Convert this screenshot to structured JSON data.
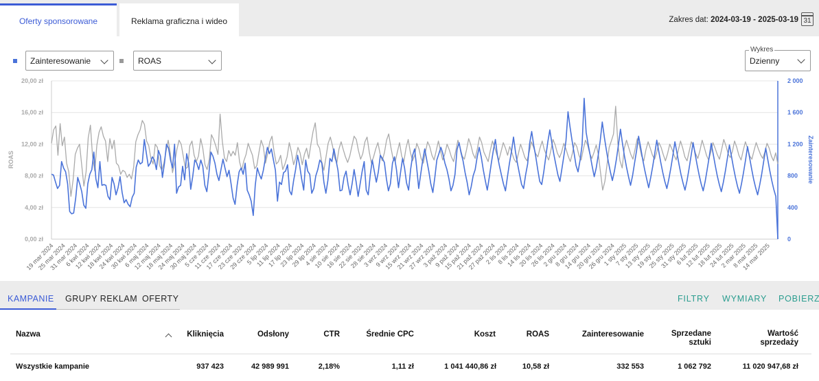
{
  "tabs": [
    {
      "label": "Oferty sponsorowane",
      "active": true
    },
    {
      "label": "Reklama graficzna i wideo",
      "active": false
    }
  ],
  "date_range": {
    "prefix": "Zakres dat: ",
    "value": "2024-03-19 - 2025-03-19",
    "calendar_day": "31"
  },
  "controls": {
    "metric1": "Zainteresowanie",
    "metric2": "ROAS",
    "chart_label": "Wykres",
    "granularity": "Dzienny",
    "metric1_color": "#4a73d9",
    "metric2_color": "#aaaaaa"
  },
  "chart_data": {
    "type": "line",
    "x_start": "2024-03-19",
    "x_end": "2025-03-19",
    "x_tick_labels": [
      "19 mar 2024",
      "25 mar 2024",
      "31 mar 2024",
      "6 kwi 2024",
      "12 kwi 2024",
      "18 kwi 2024",
      "24 kwi 2024",
      "30 kwi 2024",
      "6 maj 2024",
      "12 maj 2024",
      "18 maj 2024",
      "24 maj 2024",
      "30 maj 2024",
      "5 cze 2024",
      "11 cze 2024",
      "17 cze 2024",
      "23 cze 2024",
      "29 cze 2024",
      "5 lip 2024",
      "11 lip 2024",
      "17 lip 2024",
      "23 lip 2024",
      "29 lip 2024",
      "4 sie 2024",
      "10 sie 2024",
      "16 sie 2024",
      "22 sie 2024",
      "28 sie 2024",
      "3 wrz 2024",
      "9 wrz 2024",
      "15 wrz 2024",
      "21 wrz 2024",
      "27 wrz 2024",
      "3 paź 2024",
      "9 paź 2024",
      "15 paź 2024",
      "21 paź 2024",
      "27 paź 2024",
      "2 lis 2024",
      "8 lis 2024",
      "14 lis 2024",
      "20 lis 2024",
      "26 lis 2024",
      "2 gru 2024",
      "8 gru 2024",
      "14 gru 2024",
      "20 gru 2024",
      "26 gru 2024",
      "1 sty 2025",
      "7 sty 2025",
      "13 sty 2025",
      "19 sty 2025",
      "25 sty 2025",
      "31 sty 2025",
      "6 lut 2025",
      "12 lut 2025",
      "18 lut 2025",
      "24 lut 2025",
      "2 mar 2025",
      "8 mar 2025",
      "14 mar 2025"
    ],
    "y_left": {
      "label": "ROAS",
      "ticks": [
        "0,00 zł",
        "4,00 zł",
        "8,00 zł",
        "12,00 zł",
        "16,00 zł",
        "20,00 zł"
      ],
      "ylim": [
        0,
        20
      ]
    },
    "y_right": {
      "label": "Zainteresowanie",
      "ticks": [
        "0",
        "400",
        "800",
        "1 200",
        "1 600",
        "2 000"
      ],
      "ylim": [
        0,
        2000
      ]
    },
    "grid": true,
    "series": [
      {
        "name": "ROAS",
        "axis": "left",
        "color": "#aaaaaa",
        "values": [
          12.1,
          13.8,
          14.3,
          10.6,
          14.6,
          11.8,
          12.9,
          9.6,
          8.5,
          5.4,
          7.5,
          10.7,
          11.5,
          12.0,
          9.3,
          6.7,
          8.5,
          12.8,
          14.4,
          10.5,
          8.6,
          11.9,
          13.5,
          14.2,
          13.0,
          12.4,
          9.8,
          12.7,
          11.4,
          12.5,
          9.6,
          9.3,
          8.2,
          8.7,
          8.5,
          7.8,
          8.2,
          7.6,
          9.1,
          12.3,
          13.2,
          13.8,
          15.0,
          14.5,
          12.4,
          11.8,
          10.2,
          9.5,
          12.0,
          11.6,
          9.3,
          8.7,
          9.6,
          11.1,
          12.5,
          10.8,
          8.4,
          9.7,
          11.3,
          12.5,
          12.0,
          10.4,
          8.9,
          9.1,
          11.8,
          12.4,
          10.6,
          9.8,
          10.5,
          12.7,
          11.5,
          9.4,
          8.8,
          10.1,
          13.2,
          12.6,
          11.8,
          10.7,
          15.8,
          12.4,
          10.3,
          9.8,
          11.2,
          10.5,
          11.1,
          10.6,
          12.2,
          9.8,
          8.7,
          9.9,
          10.7,
          12.1,
          11.3,
          10.6,
          8.9,
          9.3,
          11.0,
          12.5,
          11.7,
          9.6,
          10.8,
          12.3,
          13.0,
          11.0,
          9.5,
          9.8,
          10.6,
          8.8,
          9.5,
          10.4,
          12.2,
          11.0,
          9.4,
          10.3,
          11.6,
          10.9,
          9.4,
          10.7,
          11.5,
          10.2,
          12.0,
          13.6,
          14.7,
          12.0,
          11.5,
          9.8,
          8.7,
          10.4,
          12.1,
          12.9,
          11.8,
          10.3,
          9.6,
          11.4,
          12.3,
          11.3,
          10.4,
          9.7,
          10.5,
          11.8,
          13.0,
          12.6,
          11.2,
          10.1,
          10.8,
          12.3,
          12.9,
          11.0,
          9.6,
          10.4,
          11.4,
          12.2,
          10.8,
          9.9,
          10.9,
          12.5,
          13.3,
          11.6,
          10.2,
          9.8,
          11.0,
          12.2,
          10.5,
          9.8,
          11.5,
          12.6,
          11.0,
          9.9,
          10.6,
          12.1,
          11.4,
          10.2,
          9.6,
          11.0,
          12.3,
          11.7,
          10.6,
          10.0,
          11.2,
          12.4,
          11.1,
          10.0,
          10.8,
          12.0,
          11.3,
          10.4,
          9.8,
          11.1,
          12.5,
          11.6,
          10.5,
          10.1,
          11.3,
          12.7,
          11.9,
          10.8,
          10.2,
          11.4,
          12.9,
          12.2,
          11.0,
          10.4,
          9.8,
          11.2,
          12.4,
          11.6,
          10.7,
          10.0,
          11.1,
          12.2,
          11.5,
          10.6,
          11.7,
          10.9,
          10.1,
          9.7,
          10.8,
          12.0,
          11.2,
          10.3,
          9.9,
          11.0,
          12.3,
          11.6,
          10.8,
          10.4,
          11.5,
          12.4,
          11.3,
          10.6,
          10.0,
          11.2,
          12.6,
          11.9,
          10.9,
          10.3,
          11.0,
          12.1,
          11.4,
          10.5,
          9.8,
          10.9,
          12.2,
          11.7,
          10.6,
          10.0,
          11.3,
          12.5,
          11.9,
          10.8,
          10.2,
          11.0,
          11.9,
          10.7,
          8.4,
          6.2,
          7.3,
          9.4,
          11.6,
          12.4,
          13.3,
          16.8,
          12.1,
          9.9,
          9.0,
          11.5,
          12.5,
          11.6,
          10.7,
          10.1,
          11.4,
          12.7,
          11.8,
          10.5,
          9.9,
          11.3,
          12.3,
          11.5,
          10.6,
          10.1,
          11.0,
          12.2,
          11.6,
          10.7,
          9.9,
          10.8,
          12.0,
          11.4,
          10.6,
          10.0,
          11.3,
          12.4,
          11.5,
          10.4,
          9.9,
          11.1,
          12.3,
          11.7,
          10.8,
          10.2,
          11.2,
          12.5,
          11.6,
          10.6,
          10.0,
          11.0,
          12.2,
          11.5,
          10.7,
          10.1,
          11.3,
          12.6,
          11.8,
          10.8,
          10.3,
          11.1,
          12.4,
          11.6,
          10.6,
          10.0,
          11.2,
          12.3,
          11.5,
          10.5,
          10.1,
          11.2,
          12.2,
          11.4,
          10.7,
          10.2,
          11.0,
          12.1,
          11.5,
          10.5,
          9.9,
          10.9,
          9.5
        ]
      },
      {
        "name": "Zainteresowanie",
        "axis": "right",
        "color": "#4a73d9",
        "values": [
          820,
          810,
          720,
          640,
          680,
          980,
          900,
          850,
          700,
          350,
          320,
          330,
          520,
          780,
          700,
          600,
          430,
          390,
          700,
          820,
          880,
          1100,
          760,
          650,
          980,
          680,
          690,
          680,
          540,
          500,
          780,
          700,
          560,
          650,
          790,
          590,
          460,
          500,
          440,
          410,
          530,
          580,
          910,
          1000,
          950,
          970,
          1260,
          1090,
          920,
          960,
          1040,
          1000,
          880,
          1120,
          1050,
          780,
          960,
          1200,
          1150,
          1000,
          900,
          1200,
          580,
          660,
          680,
          920,
          750,
          1080,
          960,
          630,
          790,
          1000,
          960,
          880,
          1000,
          920,
          680,
          600,
          820,
          1100,
          1050,
          960,
          820,
          740,
          880,
          1010,
          900,
          790,
          870,
          700,
          520,
          440,
          680,
          850,
          900,
          820,
          960,
          620,
          560,
          480,
          300,
          680,
          900,
          820,
          760,
          870,
          1020,
          1160,
          1080,
          1140,
          1000,
          870,
          480,
          720,
          690,
          840,
          860,
          940,
          610,
          560,
          740,
          880,
          1060,
          930,
          760,
          620,
          1000,
          860,
          820,
          580,
          640,
          800,
          880,
          1000,
          960,
          720,
          580,
          740,
          1020,
          980,
          1140,
          1000,
          870,
          610,
          620,
          780,
          860,
          690,
          560,
          700,
          880,
          720,
          540,
          700,
          860,
          980,
          620,
          560,
          810,
          1000,
          860,
          720,
          850,
          1060,
          1020,
          970,
          760,
          610,
          700,
          960,
          1040,
          880,
          650,
          840,
          1020,
          900,
          710,
          620,
          880,
          1060,
          1140,
          910,
          640,
          820,
          1000,
          1140,
          1000,
          860,
          700,
          590,
          780,
          1000,
          1080,
          1160,
          1080,
          960,
          880,
          760,
          610,
          680,
          820,
          1130,
          1220,
          1090,
          990,
          840,
          720,
          560,
          660,
          800,
          880,
          1040,
          1160,
          1040,
          880,
          740,
          620,
          780,
          960,
          1120,
          1260,
          1060,
          930,
          810,
          700,
          610,
          790,
          960,
          1110,
          1290,
          1100,
          950,
          820,
          690,
          640,
          810,
          950,
          1210,
          1360,
          1190,
          1050,
          880,
          730,
          690,
          850,
          1040,
          1230,
          1380,
          1220,
          1070,
          940,
          810,
          730,
          890,
          1060,
          1240,
          1610,
          1420,
          1250,
          1090,
          930,
          850,
          1000,
          1190,
          1780,
          1350,
          1200,
          1060,
          920,
          790,
          900,
          1060,
          1250,
          1480,
          1290,
          1130,
          980,
          850,
          740,
          860,
          1010,
          1190,
          1390,
          1210,
          1050,
          910,
          790,
          680,
          800,
          960,
          1120,
          1300,
          1160,
          1010,
          880,
          760,
          650,
          780,
          920,
          1080,
          1250,
          1110,
          970,
          840,
          730,
          640,
          760,
          900,
          1060,
          1230,
          1090,
          950,
          820,
          710,
          620,
          740,
          890,
          1050,
          1220,
          1080,
          940,
          810,
          700,
          610,
          730,
          880,
          1040,
          1210,
          1070,
          930,
          800,
          690,
          600,
          720,
          860,
          1020,
          1190,
          1050,
          910,
          780,
          670,
          580,
          700,
          840,
          1000,
          1170,
          1030,
          890,
          760,
          650,
          560,
          680,
          820,
          980,
          1150,
          1010,
          870,
          740,
          630,
          540,
          0
        ]
      }
    ]
  },
  "bottom_tabs": [
    {
      "label": "KAMPANIE",
      "active": true
    },
    {
      "label": "GRUPY REKLAM",
      "active": false
    },
    {
      "label": "OFERTY",
      "active": false
    }
  ],
  "actions": [
    "FILTRY",
    "WYMIARY",
    "POBIERZ"
  ],
  "table": {
    "headers": [
      "Nazwa",
      "Kliknięcia",
      "Odsłony",
      "CTR",
      "Średnie CPC",
      "Koszt",
      "ROAS",
      "Zainteresowanie",
      "Sprzedane\nsztuki",
      "Wartość\nsprzedaży"
    ],
    "rows": [
      [
        "Wszystkie kampanie",
        "937 423",
        "42 989 991",
        "2,18%",
        "1,11 zł",
        "1 041 440,86 zł",
        "10,58 zł",
        "332 553",
        "1 062 792",
        "11 020 947,68 zł"
      ]
    ]
  }
}
